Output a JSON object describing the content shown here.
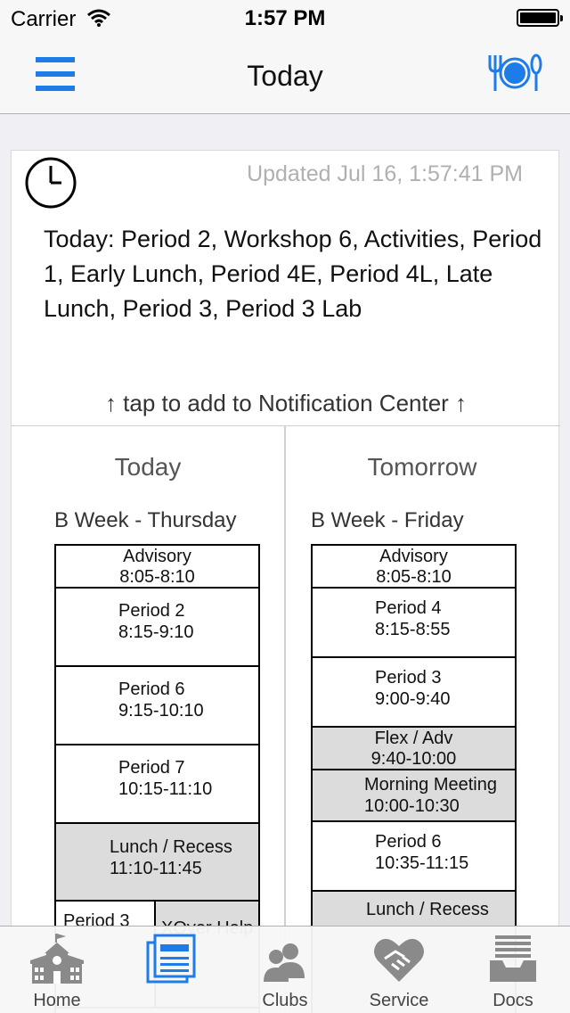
{
  "status_bar": {
    "carrier": "Carrier",
    "time": "1:57 PM"
  },
  "nav": {
    "title": "Today",
    "menu_icon": "hamburger-menu-icon",
    "right_icon": "lunch-menu-icon"
  },
  "card": {
    "updated": "Updated Jul 16, 1:57:41 PM",
    "summary": "Today: Period 2, Workshop 6, Activities, Period 1, Early Lunch, Period 4E, Period 4L, Late Lunch, Period 3, Period 3 Lab",
    "notify": "↑  tap to add to Notification Center  ↑"
  },
  "today": {
    "heading": "Today",
    "day": "B Week - Thursday",
    "blocks": [
      {
        "name": "Advisory",
        "time": "8:05-8:10"
      },
      {
        "name": "Period 2",
        "time": "8:15-9:10"
      },
      {
        "name": "Period 6",
        "time": "9:15-10:10"
      },
      {
        "name": "Period 7",
        "time": "10:15-11:10"
      },
      {
        "name": "Lunch / Recess",
        "time": "11:10-11:45"
      },
      {
        "name": "Period 3",
        "time": ""
      },
      {
        "name": "XOver Help",
        "time": ""
      }
    ]
  },
  "tomorrow": {
    "heading": "Tomorrow",
    "day": "B Week - Friday",
    "blocks": [
      {
        "name": "Advisory",
        "time": "8:05-8:10"
      },
      {
        "name": "Period 4",
        "time": "8:15-8:55"
      },
      {
        "name": "Period 3",
        "time": "9:00-9:40"
      },
      {
        "name": "Flex / Adv",
        "time": "9:40-10:00"
      },
      {
        "name": "Morning Meeting",
        "time": "10:00-10:30"
      },
      {
        "name": "Period 6",
        "time": "10:35-11:15"
      },
      {
        "name": "Lunch / Recess",
        "time": ""
      }
    ]
  },
  "tabs": [
    {
      "label": "Home",
      "icon": "school-building-icon"
    },
    {
      "label": "",
      "icon": "schedule-list-icon"
    },
    {
      "label": "Clubs",
      "icon": "people-icon"
    },
    {
      "label": "Service",
      "icon": "heart-handshake-icon"
    },
    {
      "label": "Docs",
      "icon": "document-tray-icon"
    }
  ],
  "colors": {
    "accent": "#1e7ce8",
    "block_gray": "#dcdcdc"
  }
}
